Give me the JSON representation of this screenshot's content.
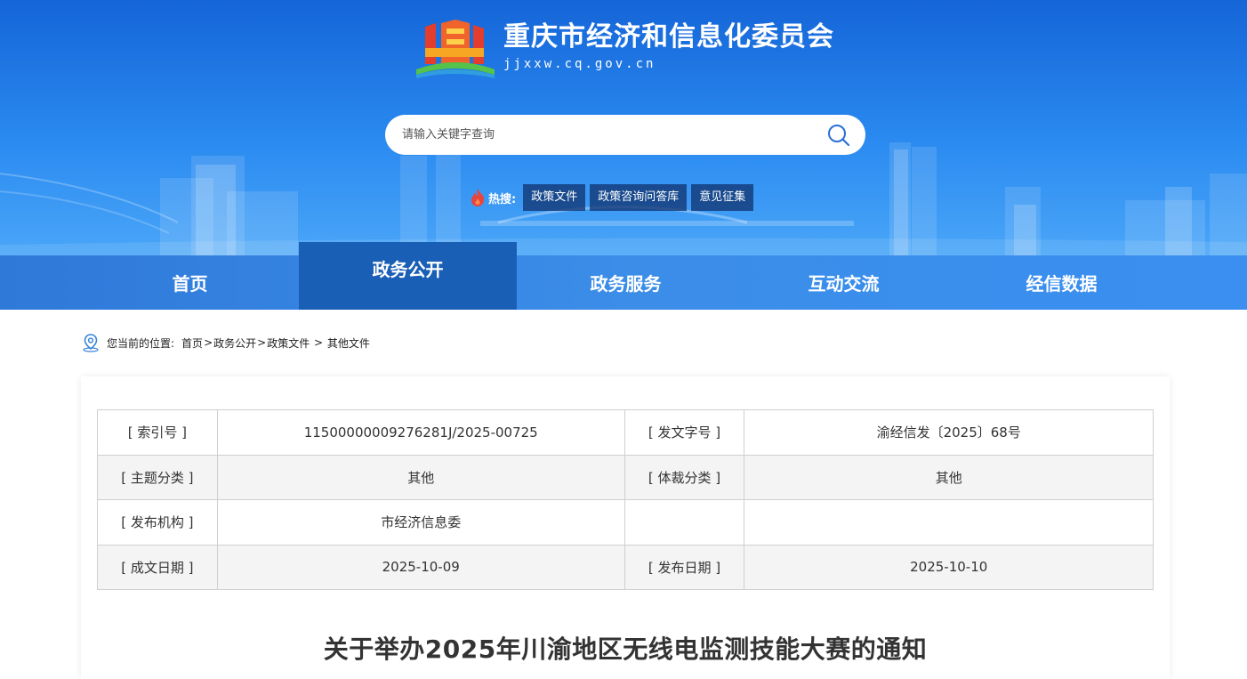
{
  "site": {
    "title": "重庆市经济和信息化委员会",
    "url": "jjxxw.cq.gov.cn"
  },
  "search": {
    "placeholder": "请输入关键字查询"
  },
  "hot": {
    "label": "热搜:",
    "tags": [
      "政策文件",
      "政策咨询问答库",
      "意见征集"
    ]
  },
  "nav": {
    "items": [
      "首页",
      "政务公开",
      "政务服务",
      "互动交流",
      "经信数据"
    ],
    "active_index": 1
  },
  "breadcrumb": {
    "prefix": "您当前的位置:",
    "items": [
      "首页",
      "政务公开",
      "政策文件",
      "其他文件"
    ],
    "separators": [
      ">",
      ">",
      " > "
    ]
  },
  "meta": {
    "rows": [
      [
        "[ 索引号 ]",
        "11500000009276281J/2025-00725",
        "[ 发文字号 ]",
        "渝经信发〔2025〕68号"
      ],
      [
        "[ 主题分类 ]",
        "其他",
        "[ 体裁分类 ]",
        "其他"
      ],
      [
        "[ 发布机构 ]",
        "市经济信息委",
        "",
        ""
      ],
      [
        "[ 成文日期 ]",
        "2025-10-09",
        "[ 发布日期 ]",
        "2025-10-10"
      ]
    ]
  },
  "document": {
    "title": "关于举办2025年川渝地区无线电监测技能大赛的通知"
  },
  "colors": {
    "header_top": "#1565d8",
    "nav_active": "#1a5fb6",
    "hot_icon": "#e8453c"
  }
}
